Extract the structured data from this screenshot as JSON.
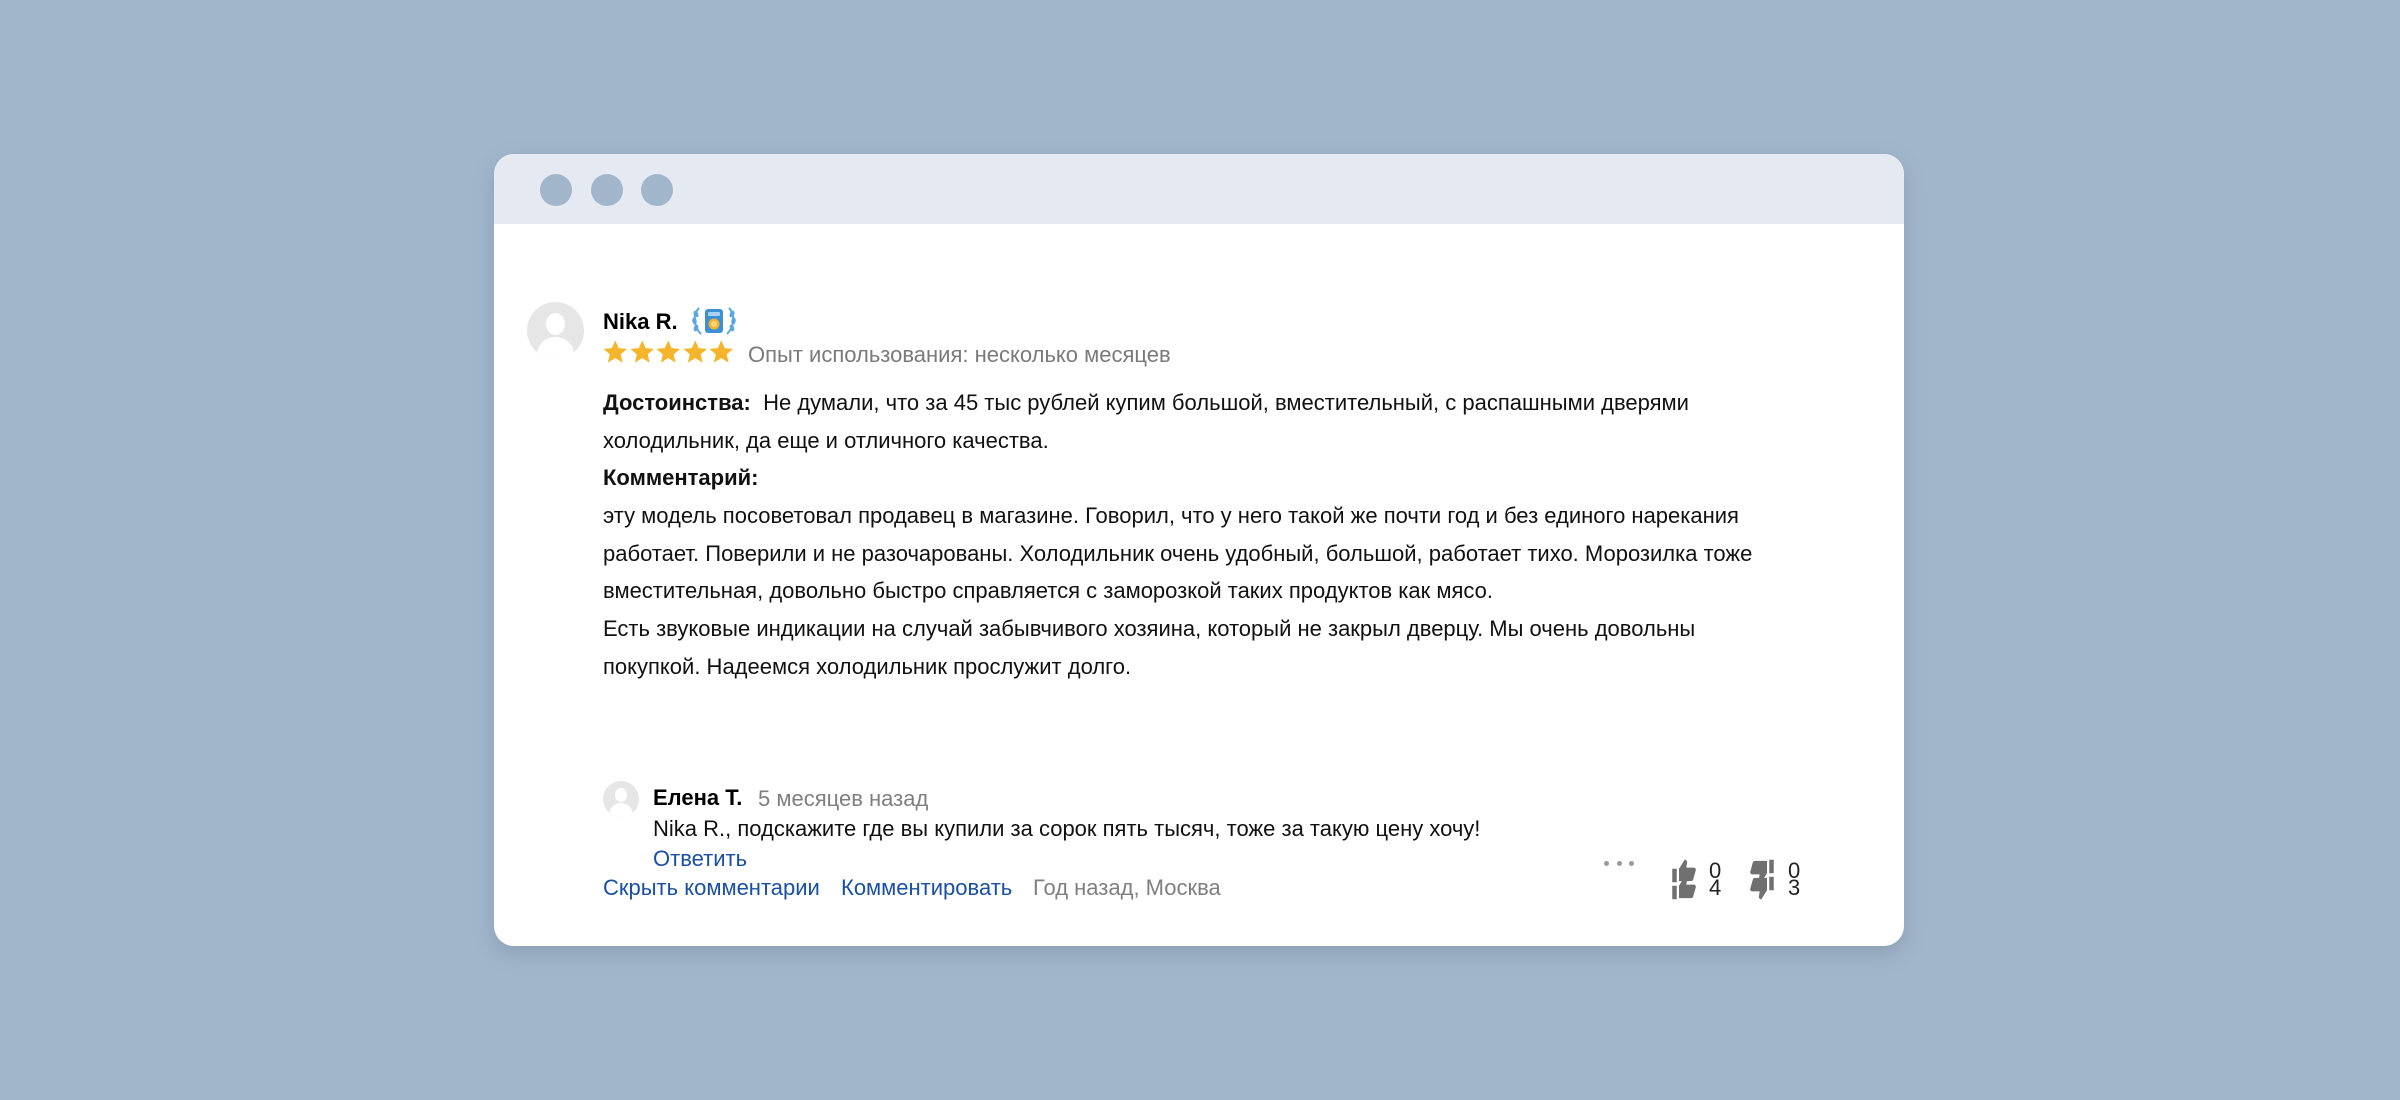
{
  "window": {
    "controls": [
      "window-dot",
      "window-dot",
      "window-dot"
    ]
  },
  "review": {
    "author": "Nika R.",
    "badge_icon": "laurel-badge-icon",
    "rating": 5,
    "rating_max": 5,
    "experience": "Опыт использования: несколько месяцев",
    "advantages_label": "Достоинства:",
    "advantages_text": "Не думали, что за 45 тыс рублей купим большой, вместительный, с распашными дверями холодильник, да еще и отличного качества.",
    "comment_label": "Комментарий:",
    "comment_lines": [
      "эту модель посоветовал продавец в магазине. Говорил, что у него такой же почти год и без единого нарекания",
      "работает. Поверили и не разочарованы. Холодильник очень удобный, большой, работает тихо. Морозилка тоже",
      "вместительная, довольно быстро справляется с заморозкой таких продуктов как мясо.",
      "Есть звуковые индикации на случай забывчивого хозяина, который не закрыл дверцу. Мы очень довольны",
      "покупкой. Надеемся холодильник прослужит долго."
    ],
    "hide_comments_label": "Скрыть комментарии",
    "comment_action_label": "Комментировать",
    "meta": "Год назад, Москва",
    "likes": "4",
    "dislikes": "3"
  },
  "reply": {
    "author": "Елена Т.",
    "time": "5 месяцев назад",
    "text": "Nika R., подскажите где вы купили за сорок пять тысяч, тоже за такую цену хочу!",
    "reply_label": "Ответить",
    "likes": "0",
    "dislikes": "0"
  },
  "colors": {
    "page_background": "#a2b6cb",
    "titlebar": "#e5e9f1",
    "link": "#1a4fa3",
    "star": "#f5b42b",
    "muted_text": "#7f7f7f"
  }
}
